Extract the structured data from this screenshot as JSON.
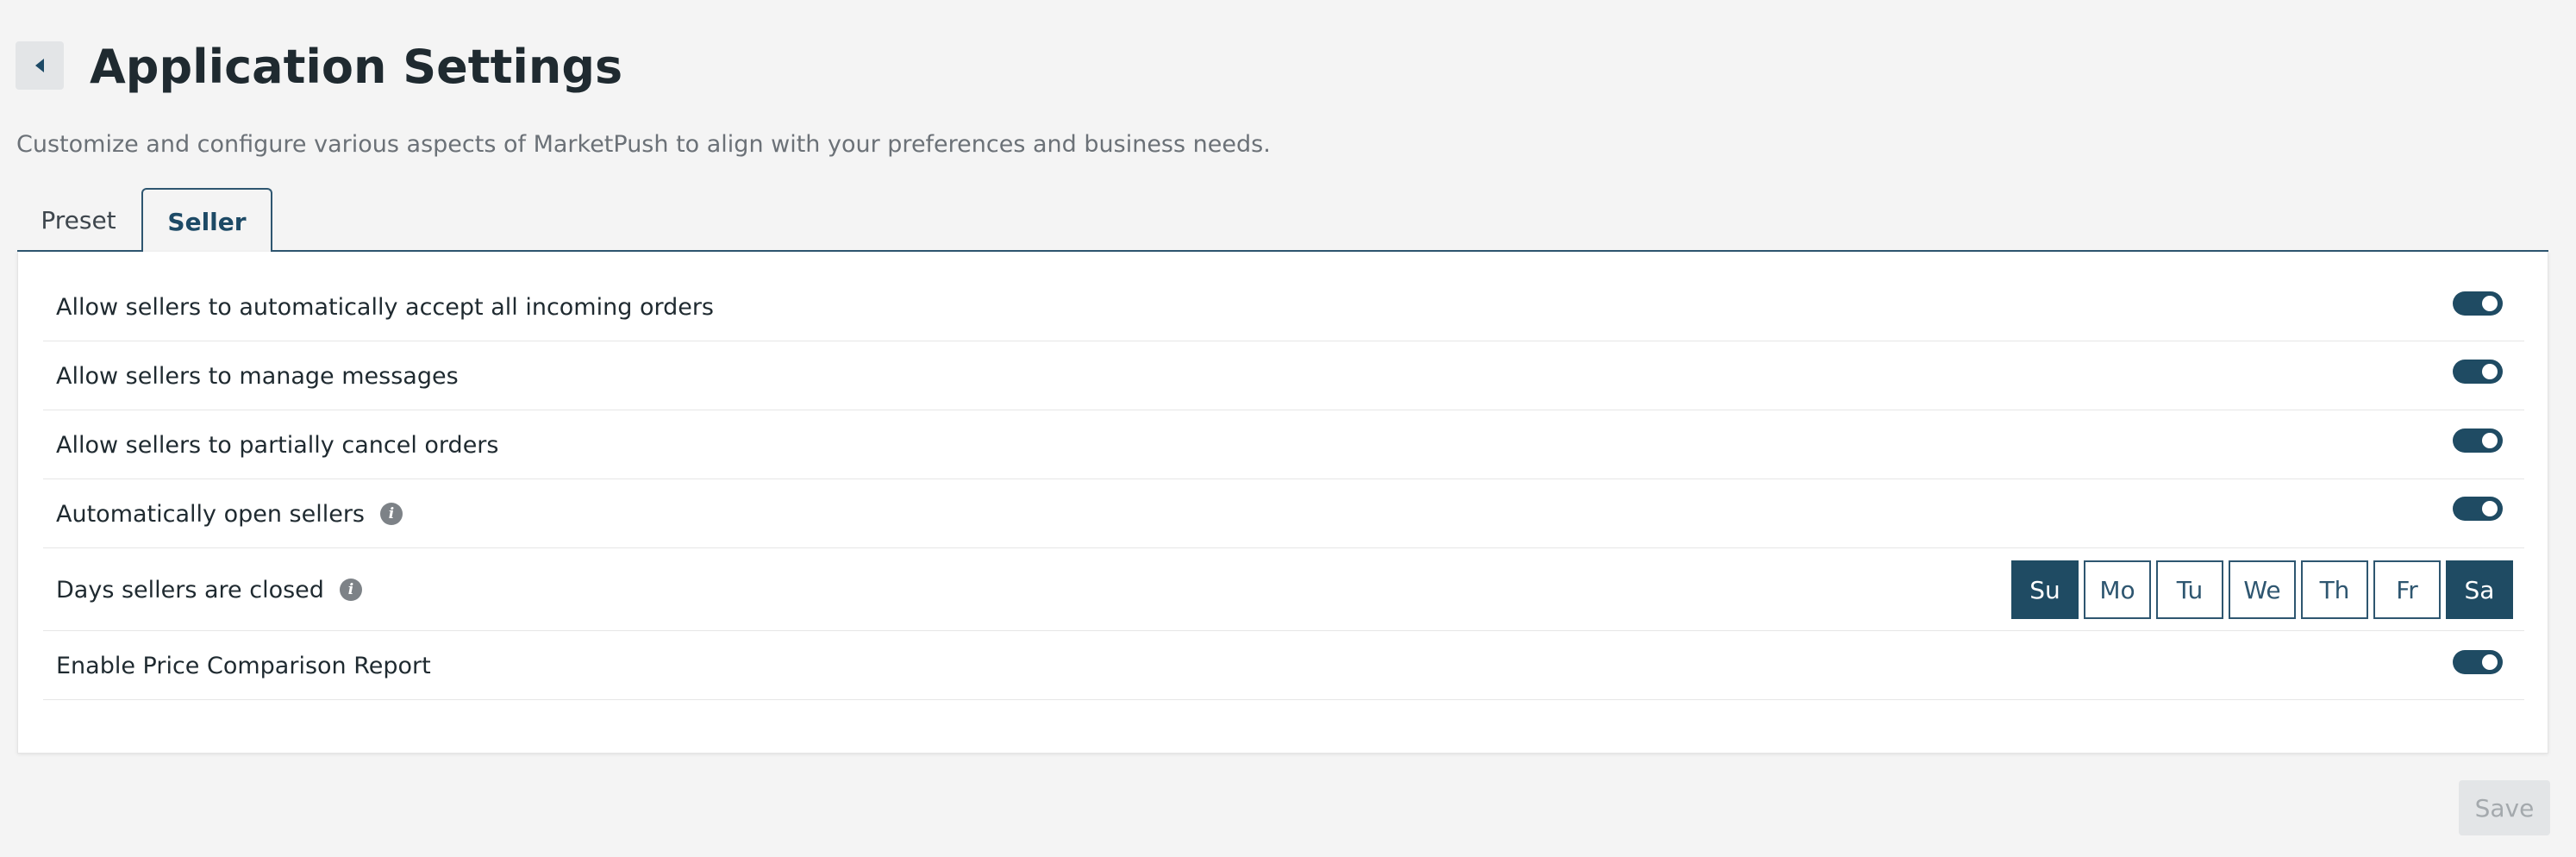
{
  "header": {
    "title": "Application Settings",
    "subtitle": "Customize and configure various aspects of MarketPush to align with your preferences and business needs.",
    "back_icon": "caret-left-icon"
  },
  "tabs": [
    {
      "label": "Preset",
      "active": false
    },
    {
      "label": "Seller",
      "active": true
    }
  ],
  "settings": [
    {
      "label": "Allow sellers to automatically accept all incoming orders",
      "control": "toggle",
      "enabled": true
    },
    {
      "label": "Allow sellers to manage messages",
      "control": "toggle",
      "enabled": true
    },
    {
      "label": "Allow sellers to partially cancel orders",
      "control": "toggle",
      "enabled": true
    },
    {
      "label": "Automatically open sellers",
      "control": "toggle",
      "enabled": true,
      "info_icon": true
    },
    {
      "label": "Days sellers are closed",
      "control": "days",
      "info_icon": true
    },
    {
      "label": "Enable Price Comparison Report",
      "control": "toggle",
      "enabled": true
    }
  ],
  "closed_days": {
    "days": [
      {
        "label": "Su",
        "selected": true
      },
      {
        "label": "Mo",
        "selected": false
      },
      {
        "label": "Tu",
        "selected": false
      },
      {
        "label": "We",
        "selected": false
      },
      {
        "label": "Th",
        "selected": false
      },
      {
        "label": "Fr",
        "selected": false
      },
      {
        "label": "Sa",
        "selected": true
      }
    ]
  },
  "footer": {
    "save_label": "Save",
    "save_disabled": true
  },
  "colors": {
    "accent": "#1f4b63",
    "background": "#f4f4f4",
    "disabled": "#e3e5e7"
  }
}
